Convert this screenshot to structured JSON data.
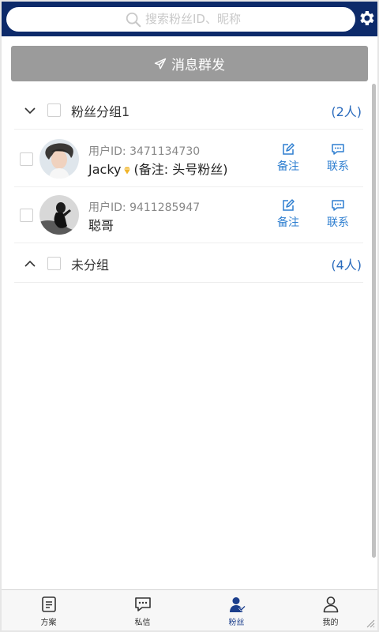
{
  "header": {
    "search_placeholder": "搜索粉丝ID、昵称",
    "settings_icon": "gear-icon",
    "background_color": "#0d2a6a"
  },
  "broadcast": {
    "label": "消息群发",
    "icon": "send-icon"
  },
  "groups": [
    {
      "name": "粉丝分组1",
      "count": "(2人)",
      "expanded": true
    },
    {
      "name": "未分组",
      "count": "(4人)",
      "expanded": false
    }
  ],
  "fans": [
    {
      "uid": "用户ID: 3471134730",
      "name": "Jacky",
      "remark": "(备注: 头号粉丝)",
      "vip": true
    },
    {
      "uid": "用户ID: 9411285947",
      "name": "聪哥",
      "remark": "",
      "vip": false
    }
  ],
  "actions": {
    "note_label": "备注",
    "contact_label": "联系"
  },
  "nav": {
    "items": [
      {
        "label": "方案",
        "icon": "document-icon"
      },
      {
        "label": "私信",
        "icon": "message-icon"
      },
      {
        "label": "粉丝",
        "icon": "fans-icon"
      },
      {
        "label": "我的",
        "icon": "profile-icon"
      }
    ],
    "active": "粉丝"
  },
  "colors": {
    "accent": "#2a6bbd",
    "action": "#2f7fd0",
    "vip": "#f0b429",
    "button": "#9b9b9b"
  }
}
